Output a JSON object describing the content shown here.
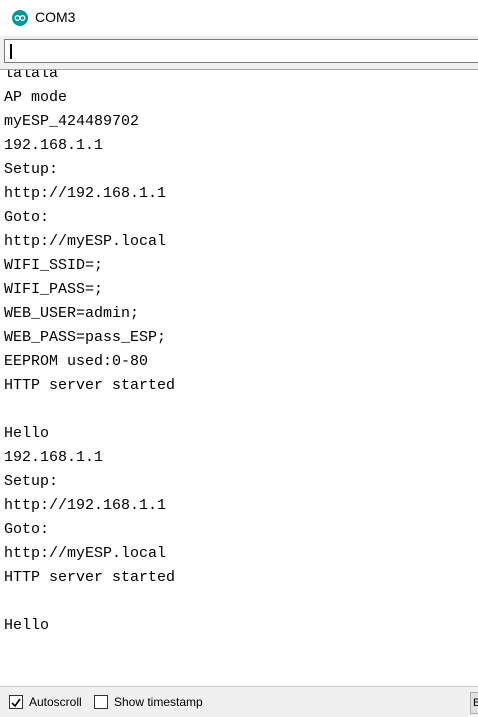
{
  "window": {
    "title": "COM3",
    "icon": "arduino-icon",
    "accent": "#00979d"
  },
  "send_input": {
    "value": ""
  },
  "output": {
    "lines": [
      "lalala",
      "AP mode",
      "myESP_424489702",
      "192.168.1.1",
      "Setup:",
      "http://192.168.1.1",
      "Goto:",
      "http://myESP.local",
      "WIFI_SSID=;",
      "WIFI_PASS=;",
      "WEB_USER=admin;",
      "WEB_PASS=pass_ESP;",
      "EEPROM used:0-80",
      "HTTP server started",
      "",
      "Hello",
      "192.168.1.1",
      "Setup:",
      "http://192.168.1.1",
      "Goto:",
      "http://myESP.local",
      "HTTP server started",
      "",
      "Hello"
    ]
  },
  "footer": {
    "autoscroll_label": "Autoscroll",
    "autoscroll_checked": true,
    "timestamp_label": "Show timestamp",
    "timestamp_checked": false,
    "line_ending_partial": "B"
  }
}
